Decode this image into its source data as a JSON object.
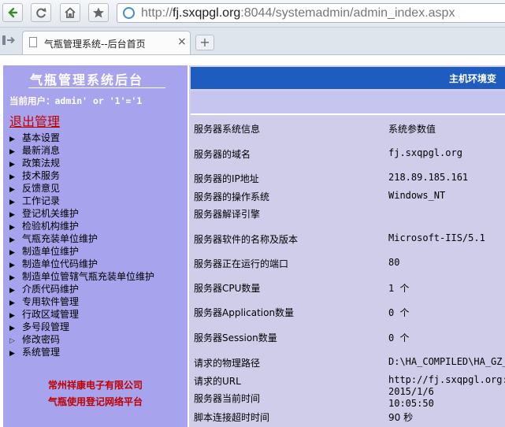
{
  "browser": {
    "url_host": "fj.sxqpgl.org",
    "url_prefix": "http://",
    "url_suffix": ":8044/systemadmin/admin_index.aspx",
    "tab_title": "气瓶管理系统--后台首页",
    "tab_close": "×",
    "new_tab": "+"
  },
  "sidebar": {
    "title": "气瓶管理系统后台",
    "user": "当前用户：admin' or '1'='1",
    "logout": "退出管理",
    "menu": [
      "基本设置",
      "最新消息",
      "政策法规",
      "技术服务",
      "反馈意见",
      "工作记录",
      "登记机关维护",
      "检验机构维护",
      "气瓶充装单位维护",
      "制造单位维护",
      "制造单位代码维护",
      "制造单位管辖气瓶充装单位维护",
      "介质代码维护",
      "专用软件管理",
      "行政区域管理",
      "多号段管理",
      "修改密码",
      "系统管理"
    ],
    "company_1": "常州祥康电子有限公司",
    "company_2": "气瓶使用登记网络平台"
  },
  "main": {
    "header": "主机环境变",
    "rows": [
      {
        "k": "服务器系统信息",
        "v": "系统参数值"
      },
      {
        "k": "服务器的域名",
        "v": "fj.sxqpgl.org"
      },
      {
        "k": "服务器的IP地址",
        "v": "218.89.185.161"
      },
      {
        "k": "服务器的操作系统",
        "v": "Windows_NT"
      },
      {
        "k": "服务器解译引擎",
        "v": ""
      },
      {
        "k": "服务器软件的名称及版本",
        "v": "Microsoft-IIS/5.1"
      },
      {
        "k": "服务器正在运行的端口",
        "v": "80"
      },
      {
        "k": "服务器CPU数量",
        "v": "1 个"
      },
      {
        "k": "服务器Application数量",
        "v": "0 个"
      },
      {
        "k": "服务器Session数量",
        "v": "0 个"
      },
      {
        "k": "请求的物理路径",
        "v": "D:\\HA_COMPILED\\HA_GZ_"
      },
      {
        "k": "请求的URL",
        "v": "http://fj.sxqpgl.org:"
      },
      {
        "k": "服务器当前时间",
        "v": "2015/1/6"
      },
      {
        "k": "",
        "v": "10:05:50"
      },
      {
        "k": "脚本连接超时时间",
        "v": "90 秒"
      }
    ]
  }
}
